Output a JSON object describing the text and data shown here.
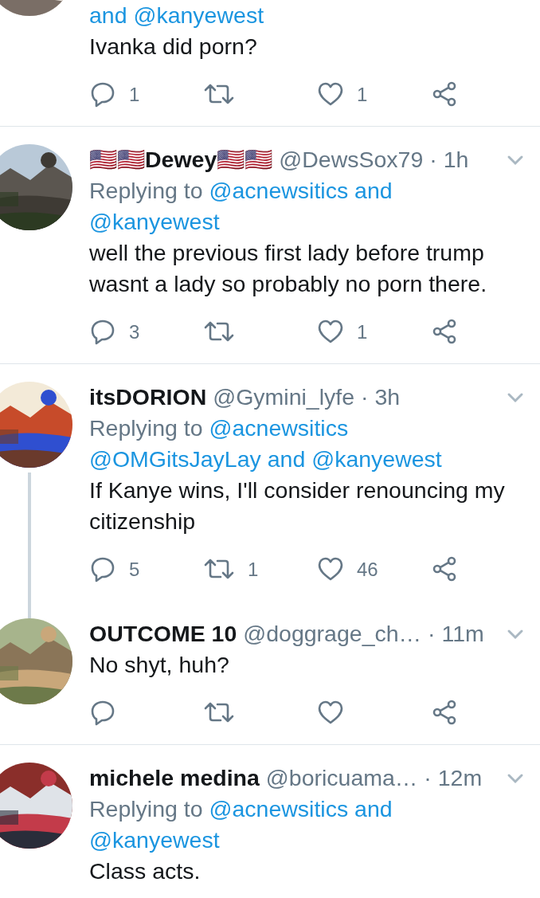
{
  "tweets": [
    {
      "replying": {
        "mentions": [
          "and @kanyewest"
        ]
      },
      "text": "Ivanka did porn?",
      "actions": [
        {
          "kind": "reply",
          "count": "1"
        },
        {
          "kind": "retweet"
        },
        {
          "kind": "like",
          "count": "1"
        },
        {
          "kind": "share"
        }
      ],
      "connected_below": false
    },
    {
      "name": "🇺🇸🇺🇸Dewey🇺🇸🇺🇸",
      "handle": "@DewsSox79",
      "time": "· 1h",
      "replying": {
        "prefix": "Replying to",
        "mentions": [
          "@acnewsitics and",
          "@kanyewest"
        ]
      },
      "text": "well the previous first lady before trump wasnt a lady so probably no porn there.",
      "actions": [
        {
          "kind": "reply",
          "count": "3"
        },
        {
          "kind": "retweet"
        },
        {
          "kind": "like",
          "count": "1"
        },
        {
          "kind": "share"
        }
      ],
      "connected_below": false
    },
    {
      "name": "itsDORION",
      "handle": "@Gymini_lyfe",
      "time": "· 3h",
      "replying": {
        "prefix": "Replying to",
        "mentions": [
          "@acnewsitics",
          "@OMGitsJayLay and @kanyewest"
        ]
      },
      "text": "If Kanye wins, I'll consider renouncing my citizenship",
      "actions": [
        {
          "kind": "reply",
          "count": "5"
        },
        {
          "kind": "retweet",
          "count": "1"
        },
        {
          "kind": "like",
          "count": "46"
        },
        {
          "kind": "share"
        }
      ],
      "connected_below": true
    },
    {
      "name": "OUTCOME 10",
      "handle": "@doggrage_ch…",
      "time": "· 11m",
      "text": "No shyt, huh?",
      "actions": [
        {
          "kind": "reply"
        },
        {
          "kind": "retweet"
        },
        {
          "kind": "like"
        },
        {
          "kind": "share"
        }
      ],
      "connected_below": false
    },
    {
      "name": "michele medina",
      "handle": "@boricuama…",
      "time": "· 12m",
      "replying": {
        "prefix": "Replying to",
        "mentions": [
          "@acnewsitics and",
          "@kanyewest"
        ]
      },
      "text": "Class acts.",
      "connected_below": false
    }
  ]
}
